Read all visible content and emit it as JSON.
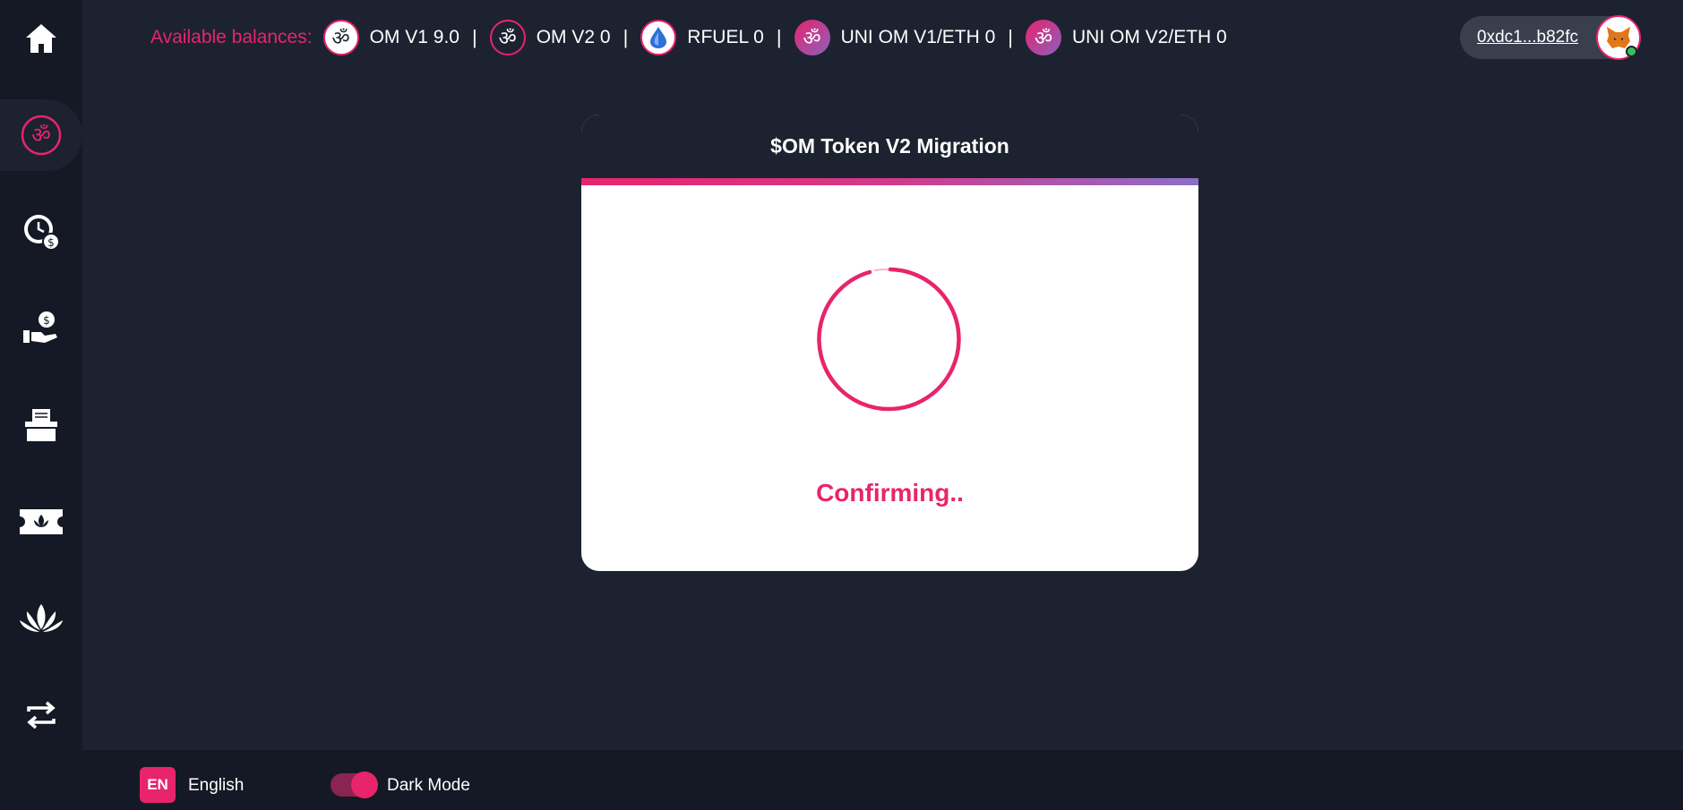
{
  "balances": {
    "label": "Available balances:",
    "tokens": [
      {
        "icon": "om-icon",
        "text": "OM V1 9.0"
      },
      {
        "icon": "om-icon",
        "text": "OM V2 0"
      },
      {
        "icon": "rfuel-icon",
        "text": "RFUEL 0"
      },
      {
        "icon": "om-icon",
        "text": "UNI OM V1/ETH 0"
      },
      {
        "icon": "om-icon",
        "text": "UNI OM V2/ETH 0"
      }
    ],
    "separator": "|",
    "om_glyph": "ॐ"
  },
  "wallet": {
    "address": "0xdc1...b82fc",
    "avatar_icon": "metamask-fox-icon",
    "status_color": "#3bbf5a"
  },
  "sidebar": {
    "items": [
      {
        "icon": "home-icon",
        "active": false
      },
      {
        "icon": "om-icon",
        "active": true
      },
      {
        "icon": "clock-dollar-icon",
        "active": false
      },
      {
        "icon": "hand-coin-icon",
        "active": false
      },
      {
        "icon": "ballot-box-icon",
        "active": false
      },
      {
        "icon": "lotus-ticket-icon",
        "active": false
      },
      {
        "icon": "lotus-icon",
        "active": false
      },
      {
        "icon": "swap-arrows-icon",
        "active": false
      }
    ]
  },
  "modal": {
    "title": "$OM Token V2 Migration",
    "status": "Confirming.."
  },
  "footer": {
    "language_code": "EN",
    "language": "English",
    "dark_mode_label": "Dark Mode",
    "dark_mode_on": true
  },
  "colors": {
    "accent": "#e8246c",
    "background": "#1d2230",
    "sidebar": "#141925",
    "gradient_end": "#8b6fc7"
  }
}
